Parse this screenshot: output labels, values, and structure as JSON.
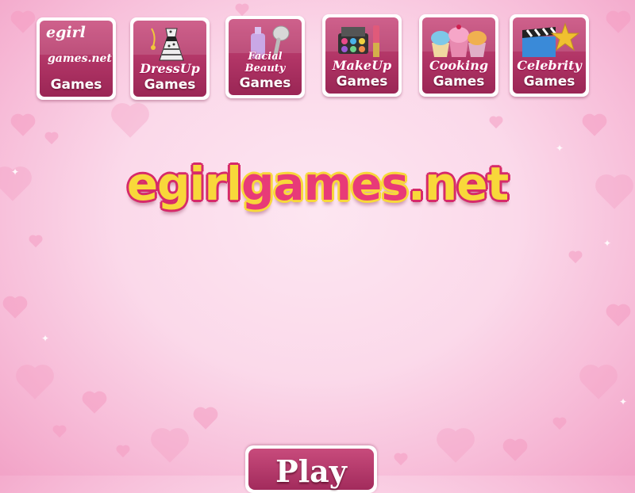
{
  "nav": {
    "tiles": [
      {
        "brand": "egirl",
        "brand_sub": "games.net",
        "label": "Games",
        "icon": "egirlgames-logo"
      },
      {
        "category": "DressUp",
        "label": "Games",
        "icon": "dress-icon"
      },
      {
        "category": "Facial Beauty",
        "label": "Games",
        "icon": "shower-lotion-icon"
      },
      {
        "category": "MakeUp",
        "label": "Games",
        "icon": "makeup-palette-icon"
      },
      {
        "category": "Cooking",
        "label": "Games",
        "icon": "cupcake-icon"
      },
      {
        "category": "Celebrity",
        "label": "Games",
        "icon": "clapperboard-star-icon"
      }
    ]
  },
  "logo": {
    "part1": "egirl",
    "part2": "games",
    "part3": ".net"
  },
  "play_button": {
    "label": "Play"
  },
  "colors": {
    "tile": "#b03465",
    "logo_yellow": "#f8d83a",
    "logo_pink": "#e83a78",
    "background": "#fbd9ea"
  }
}
